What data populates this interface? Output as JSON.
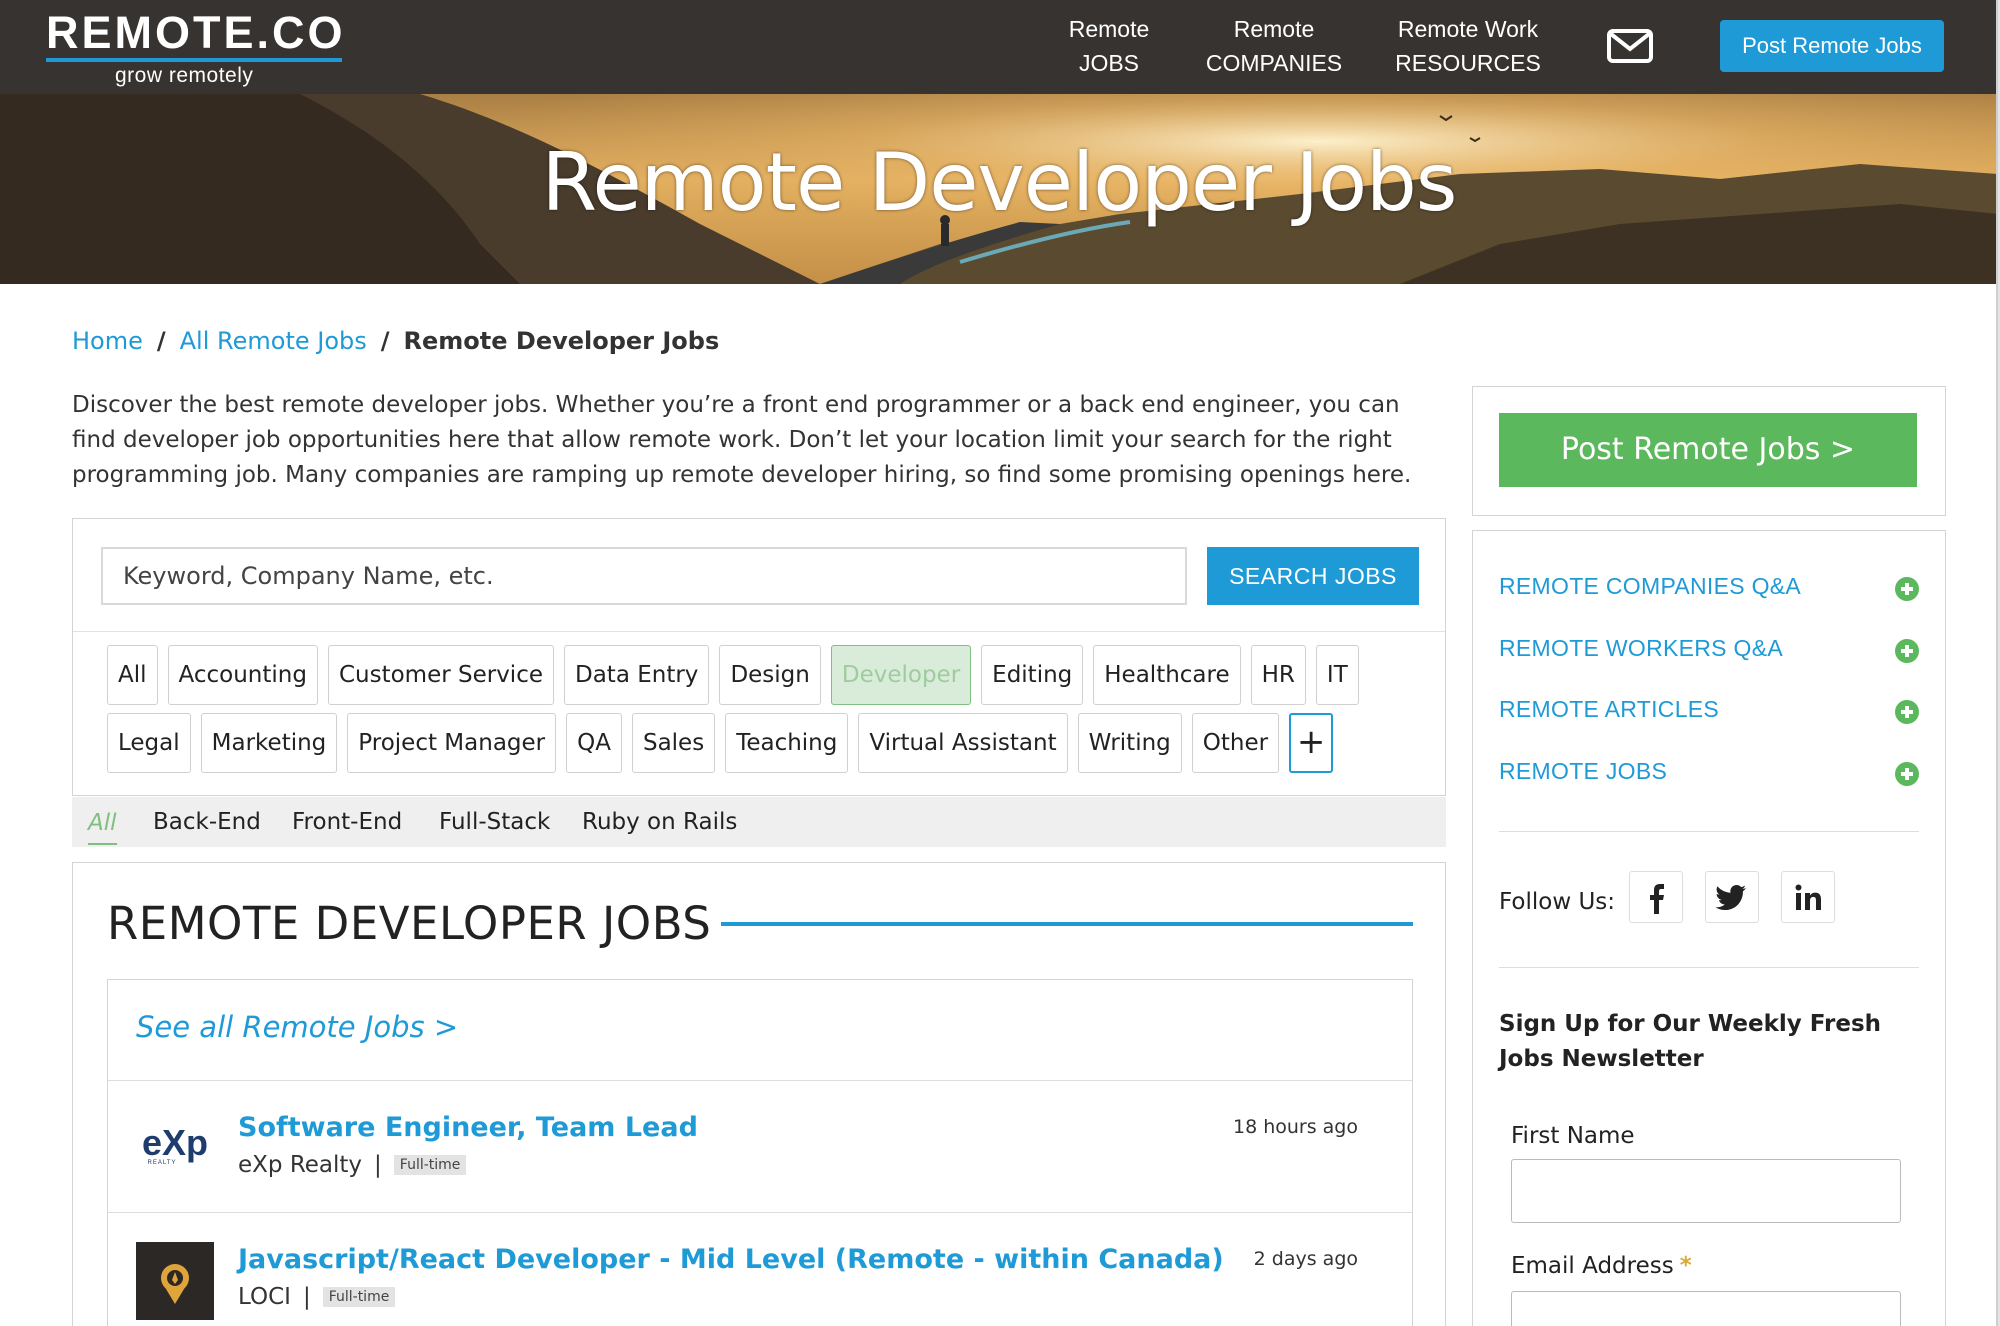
{
  "header": {
    "logo_text": "REMOTE.CO",
    "logo_tagline": "grow remotely",
    "nav": [
      {
        "line1": "Remote",
        "line2": "JOBS"
      },
      {
        "line1": "Remote",
        "line2": "COMPANIES"
      },
      {
        "line1": "Remote Work",
        "line2": "RESOURCES"
      }
    ],
    "mail_icon": "envelope-icon",
    "post_button": "Post Remote Jobs"
  },
  "hero": {
    "title": "Remote Developer Jobs"
  },
  "breadcrumb": {
    "home": "Home",
    "all_jobs": "All Remote Jobs",
    "sep": "/",
    "current": "Remote Developer Jobs"
  },
  "intro": "Discover the best remote developer jobs. Whether you’re a front end programmer or a back end engineer, you can find developer job opportunities here that allow remote work. Don’t let your location limit your search for the right programming job. Many companies are ramping up remote developer hiring, so find some promising openings here.",
  "search": {
    "placeholder": "Keyword, Company Name, etc.",
    "button": "SEARCH JOBS"
  },
  "categories_row1": [
    "All",
    "Accounting",
    "Customer Service",
    "Data Entry",
    "Design",
    "Developer",
    "Editing",
    "Healthcare",
    "HR",
    "IT"
  ],
  "categories_row2": [
    "Legal",
    "Marketing",
    "Project Manager",
    "QA",
    "Sales",
    "Teaching",
    "Virtual Assistant",
    "Writing",
    "Other"
  ],
  "active_category": "Developer",
  "more_categories": "+",
  "subcategories": [
    "All",
    "Back-End",
    "Front-End",
    "Full-Stack",
    "Ruby on Rails"
  ],
  "jobs": {
    "heading": "REMOTE DEVELOPER JOBS",
    "see_all": "See all Remote Jobs >",
    "items": [
      {
        "title": "Software Engineer, Team Lead",
        "company": "eXp Realty",
        "type": "Full-time",
        "posted": "18 hours ago",
        "logo_text": "eXp",
        "logo_sub": "REALTY"
      },
      {
        "title": "Javascript/React Developer - Mid Level (Remote - within Canada)",
        "company": "LOCI",
        "type": "Full-time",
        "posted": "2 days ago"
      }
    ]
  },
  "sidebar": {
    "post_button": "Post Remote Jobs >",
    "links": [
      "REMOTE COMPANIES Q&A",
      "REMOTE WORKERS Q&A",
      "REMOTE ARTICLES",
      "REMOTE JOBS"
    ],
    "follow_label": "Follow Us:",
    "social_icons": [
      "facebook-icon",
      "twitter-icon",
      "linkedin-icon"
    ],
    "newsletter_title": "Sign Up for Our Weekly Fresh Jobs Newsletter",
    "first_name_label": "First Name",
    "email_label": "Email Address",
    "required_mark": "*"
  },
  "colors": {
    "brand_blue": "#1e9ad6",
    "green": "#5cb85c",
    "header_bg": "#363331"
  }
}
